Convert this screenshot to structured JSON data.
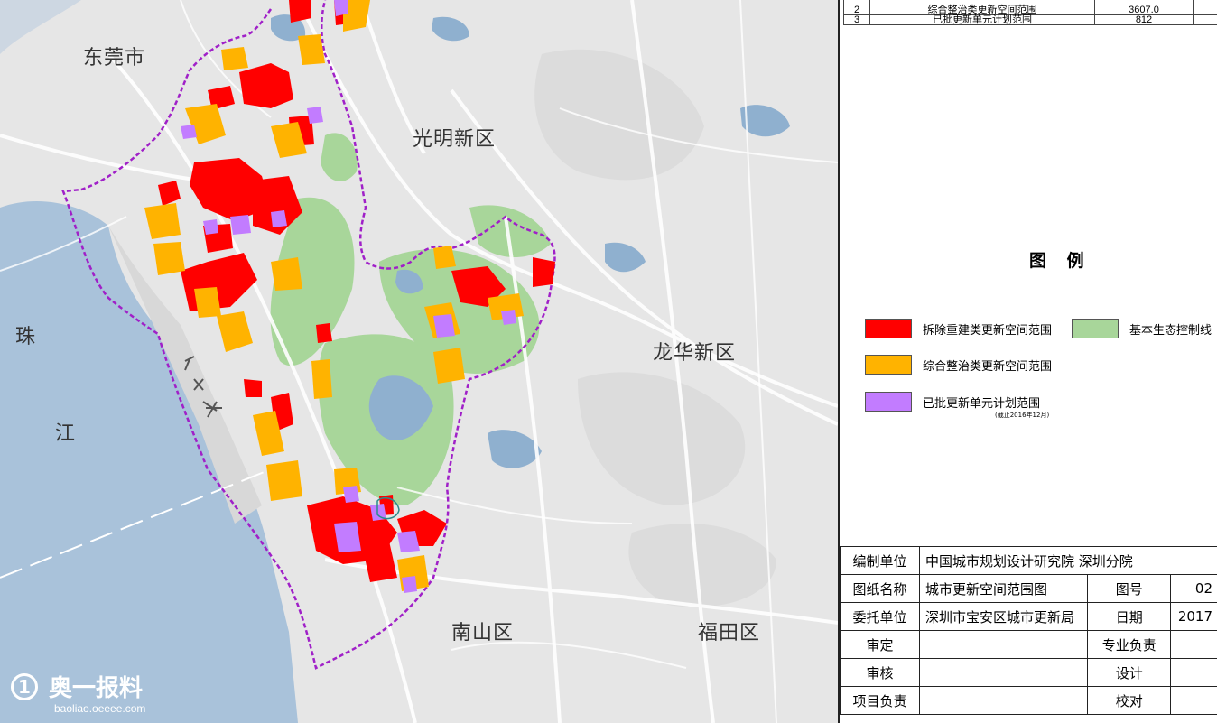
{
  "top_table": {
    "rows": [
      {
        "no": "2",
        "name": "综合整治类更新空间范围",
        "value": "3607.0"
      },
      {
        "no": "3",
        "name": "已批更新单元计划范围",
        "value": "812"
      }
    ]
  },
  "places": {
    "dongguan": "东莞市",
    "guangming": "光明新区",
    "longhua": "龙华新区",
    "nanshan": "南山区",
    "futian": "福田区",
    "zhujiang_1": "珠",
    "zhujiang_2": "江"
  },
  "legend": {
    "title": "图  例",
    "items": [
      {
        "label": "拆除重建类更新空间范围",
        "color": "#ff0000"
      },
      {
        "label": "基本生态控制线",
        "color": "#a8d69a"
      },
      {
        "label": "综合整治类更新空间范围",
        "color": "#ffb300"
      },
      {
        "label": "已批更新单元计划范围",
        "color": "#c27cff"
      }
    ],
    "note": "(截止2016年12月)"
  },
  "title_block": {
    "org_label": "编制单位",
    "org_value": "中国城市规划设计研究院  深圳分院",
    "name_label": "图纸名称",
    "name_value": "城市更新空间范围图",
    "drawing_no_label": "图号",
    "drawing_no_value": "02",
    "client_label": "委托单位",
    "client_value": "深圳市宝安区城市更新局",
    "date_label": "日期",
    "date_value": "2017",
    "review_label": "审定",
    "lead_label": "专业负责",
    "check_label": "审核",
    "design_label": "设计",
    "pm_label": "项目负责",
    "proof_label": "校对"
  },
  "watermark": {
    "logo": "1",
    "text": "奥一报料",
    "url": "baoliao.oeeee.com"
  },
  "colors": {
    "sea": "#a9c2da",
    "land": "#e6e6e6",
    "road": "#ffffff",
    "water": "#8fb0cf",
    "boundary": "#a020c8"
  }
}
